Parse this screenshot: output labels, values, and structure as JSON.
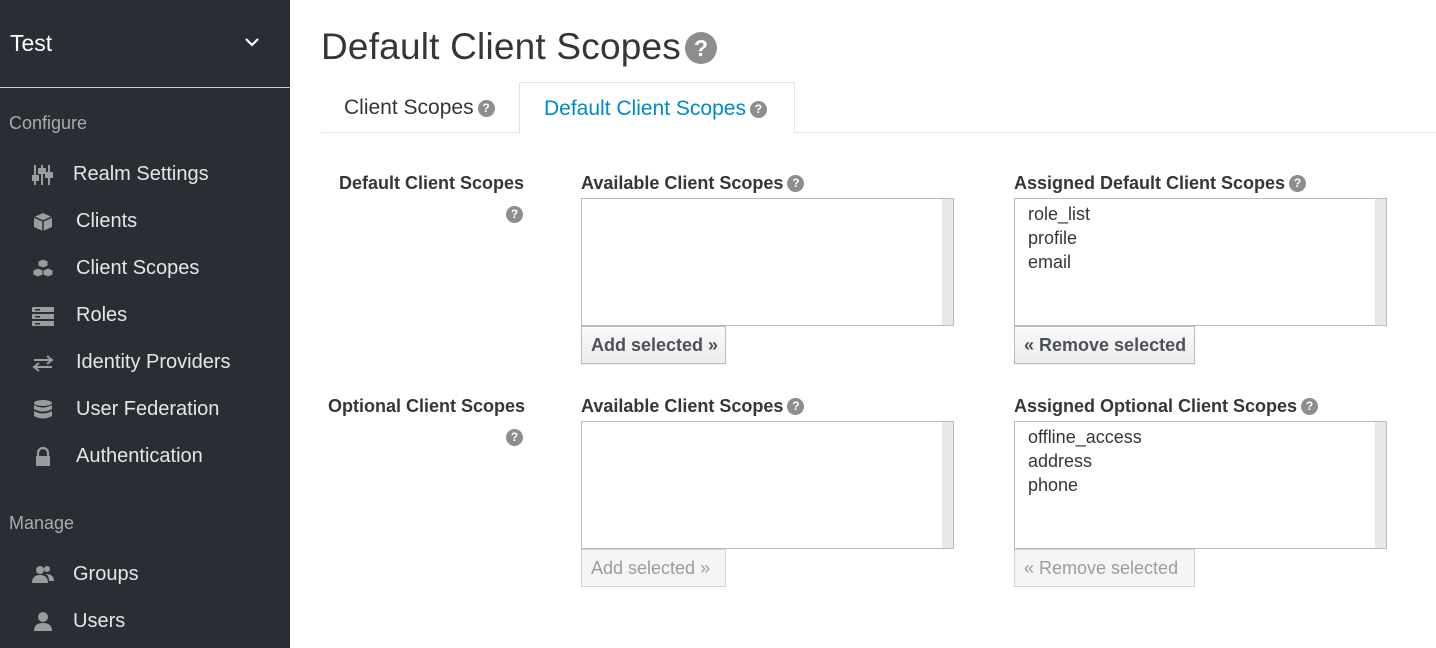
{
  "sidebar": {
    "realm": "Test",
    "sections": {
      "configure": "Configure",
      "manage": "Manage"
    },
    "configure_items": [
      {
        "label": "Realm Settings",
        "icon": "sliders-icon"
      },
      {
        "label": "Clients",
        "icon": "cube-icon"
      },
      {
        "label": "Client Scopes",
        "icon": "cubes-icon"
      },
      {
        "label": "Roles",
        "icon": "roles-icon"
      },
      {
        "label": "Identity Providers",
        "icon": "exchange-icon"
      },
      {
        "label": "User Federation",
        "icon": "database-icon"
      },
      {
        "label": "Authentication",
        "icon": "lock-icon"
      }
    ],
    "manage_items": [
      {
        "label": "Groups",
        "icon": "users-icon"
      },
      {
        "label": "Users",
        "icon": "user-icon"
      }
    ]
  },
  "page": {
    "title": "Default Client Scopes",
    "help_glyph": "?"
  },
  "tabs": [
    {
      "label": "Client Scopes",
      "active": false
    },
    {
      "label": "Default Client Scopes",
      "active": true
    }
  ],
  "default_section": {
    "label": "Default Client Scopes",
    "available_label": "Available Client Scopes",
    "assigned_label": "Assigned Default Client Scopes",
    "available": [],
    "assigned": [
      "role_list",
      "profile",
      "email"
    ],
    "add_button": "Add selected »",
    "remove_button": "« Remove selected"
  },
  "optional_section": {
    "label": "Optional Client Scopes",
    "available_label": "Available Client Scopes",
    "assigned_label": "Assigned Optional Client Scopes",
    "available": [],
    "assigned": [
      "offline_access",
      "address",
      "phone"
    ],
    "add_button": "Add selected »",
    "remove_button": "« Remove selected"
  },
  "colors": {
    "sidebar_bg": "#292e34",
    "accent": "#0088ce"
  }
}
